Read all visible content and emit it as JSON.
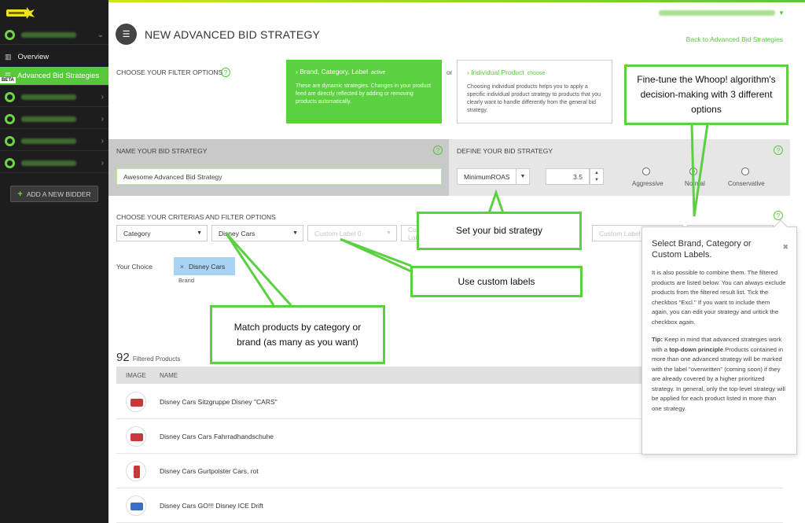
{
  "sidebar": {
    "overview_label": "Overview",
    "active_label": "Advanced Bid Strategies",
    "beta_label": "BETA",
    "add_bidder_label": "ADD A NEW BIDDER"
  },
  "header": {
    "title": "NEW ADVANCED BID STRATEGY",
    "back_link": "Back to Advanced Bid Strategies"
  },
  "filter_options": {
    "label": "CHOOSE YOUR FILTER OPTIONS",
    "active": {
      "title": "Brand, Category, Label",
      "state": "active",
      "desc": "These are dynamic strategies. Changes in your product feed are directly reflected by adding or removing products automatically."
    },
    "or_label": "or",
    "choose": {
      "title": "Individual Product",
      "state": "choose",
      "desc": "Choosing individual products helps you to apply a specific individual product strategy to products that you clearly want to handle differently from the general bid strategy."
    }
  },
  "name_section": {
    "label": "NAME YOUR BID STRATEGY",
    "value": "Awesome Advanced Bid Strategy"
  },
  "define_section": {
    "label": "DEFINE YOUR BID STRATEGY",
    "strategy": "MinimumROAS",
    "target_value": "3.5",
    "options": [
      "Aggressive",
      "Normal",
      "Conservative"
    ],
    "selected_option": "Normal"
  },
  "criteria": {
    "label": "CHOOSE YOUR CRITERIAS AND FILTER OPTIONS",
    "category_select": "Category",
    "value_select": "Disney Cars",
    "custom_label_0": "Custom Label 0",
    "custom_label_1": "Custom Label 1",
    "custom_label_3": "Custom Label 3",
    "your_choice_label": "Your Choice",
    "chip_label": "Disney Cars",
    "chip_type": "Brand"
  },
  "products": {
    "count": "92",
    "count_label": "Filtered Products",
    "columns": [
      "IMAGE",
      "NAME"
    ],
    "rows": [
      "Disney Cars Sitzgruppe Disney \"CARS\"",
      "Disney Cars Cars Fahrradhandschuhe",
      "Disney Cars Gurtpolster Cars, rot",
      "Disney Cars GO!!! Disney ICE Drift"
    ]
  },
  "callouts": {
    "finetune": "Fine-tune the Whoop! algorithm's decision-making with 3 different options",
    "bid_strategy": "Set your bid strategy",
    "custom_labels": "Use custom labels",
    "match_products": "Match products by category or brand (as many as you want)"
  },
  "popover": {
    "title": "Select Brand, Category or Custom Labels.",
    "p1": "It is also possible to combine them. The filtered products are listed below. You can always exclude products from the filtered result list. Tick the checkbos \"Excl.\" If you want to include them again, you can edit your strategy and untick the checkbox again.",
    "tip_label": "Tip:",
    "p2a": " Keep in mind that advanced strategies work with a ",
    "p2b": "top-down principle",
    "p2c": ".Products contained in more than one advanced strategy will be marked with the label \"overwritten\" (coming soon) if they are already covered by a higher prioritized strategy. In general, only the top-level strategy will be applied for each product listed in more than one strategy."
  },
  "colors": {
    "accent": "#5bd040",
    "sidebar": "#1d1d1d",
    "chip": "#a9d3f5"
  },
  "icons": [
    "whoop-logo",
    "bar-chart-icon",
    "list-icon",
    "chevron-right-icon",
    "plus-icon",
    "help-icon",
    "close-icon"
  ]
}
